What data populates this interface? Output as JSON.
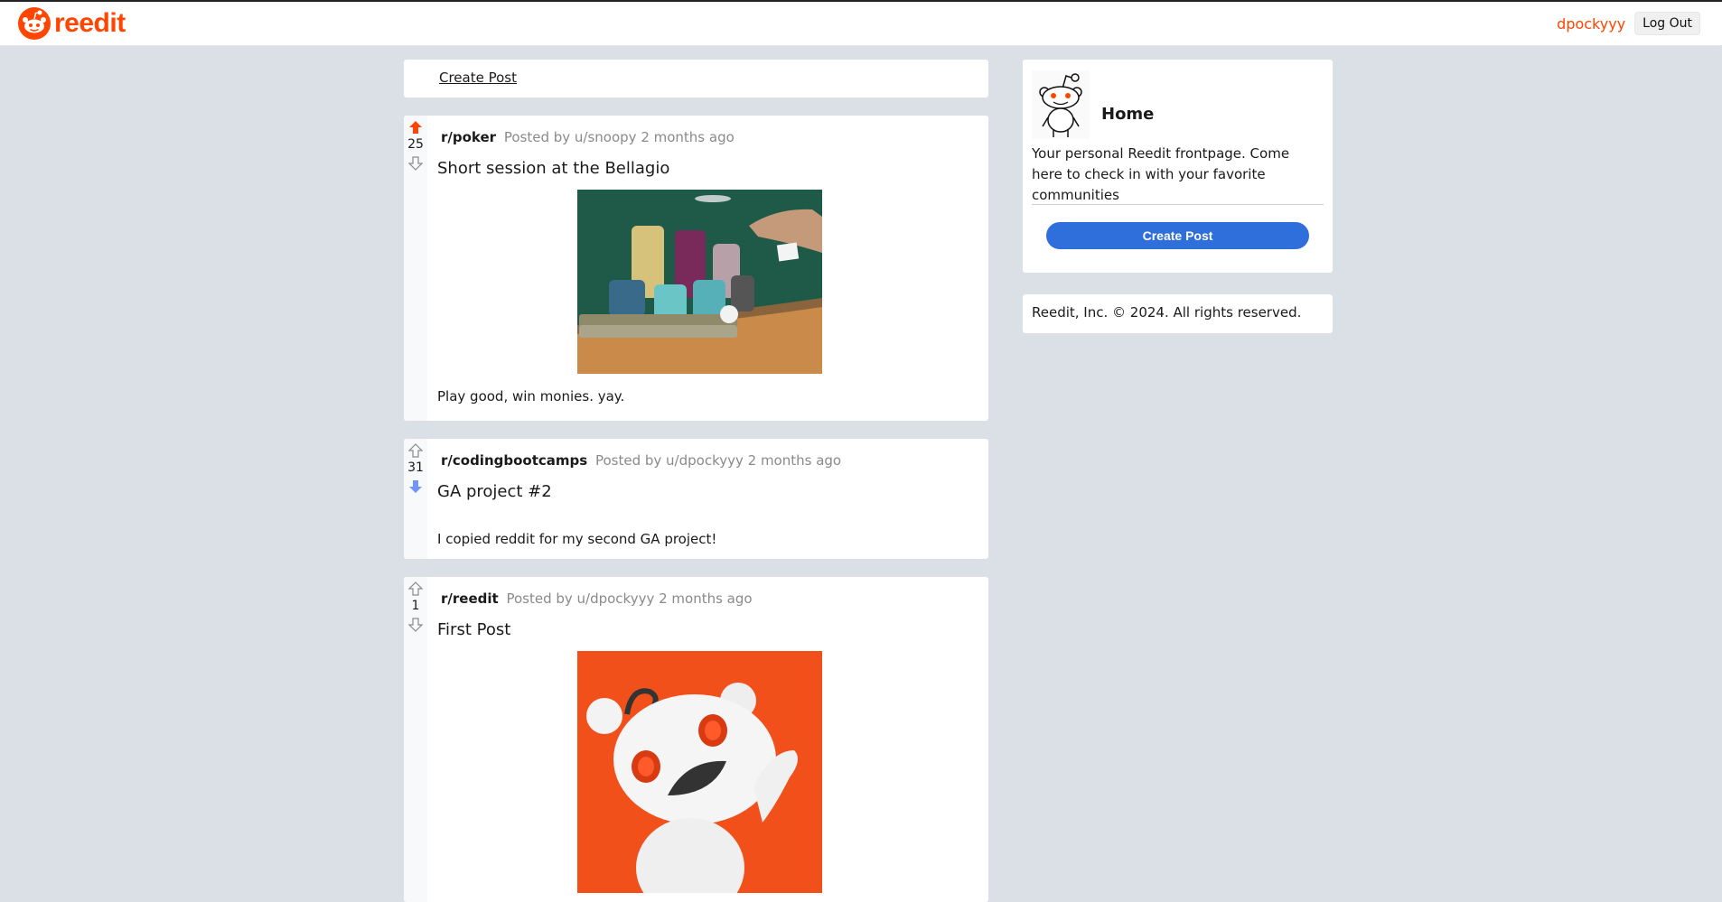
{
  "nav": {
    "logo_text": "reedit",
    "username": "dpockyyy",
    "logout_label": "Log Out"
  },
  "feed": {
    "create_post_label": "Create Post"
  },
  "posts": [
    {
      "subreddit": "r/poker",
      "posted": "Posted by u/snoopy 2 months ago",
      "score": "25",
      "vote_state": "up",
      "title": "Short session at the Bellagio",
      "body": "Play good, win monies. yay.",
      "image": "poker-chips-photo"
    },
    {
      "subreddit": "r/codingbootcamps",
      "posted": "Posted by u/dpockyyy 2 months ago",
      "score": "31",
      "vote_state": "down",
      "title": "GA project #2",
      "body": "I copied reddit for my second GA project!"
    },
    {
      "subreddit": "r/reedit",
      "posted": "Posted by u/dpockyyy 2 months ago",
      "score": "1",
      "vote_state": "none",
      "title": "First Post",
      "image": "snoo-mascot-photo"
    }
  ],
  "sidebar": {
    "home_title": "Home",
    "home_desc": "Your personal Reedit frontpage. Come here to check in with your favorite communities",
    "create_post_label": "Create Post",
    "footer": "Reedit, Inc. © 2024. All rights reserved."
  },
  "colors": {
    "brand": "#ff4500",
    "upvote_active": "#ff4500",
    "downvote_active": "#7193ff",
    "button_blue": "#2f6fdb",
    "background": "#dae0e6"
  }
}
